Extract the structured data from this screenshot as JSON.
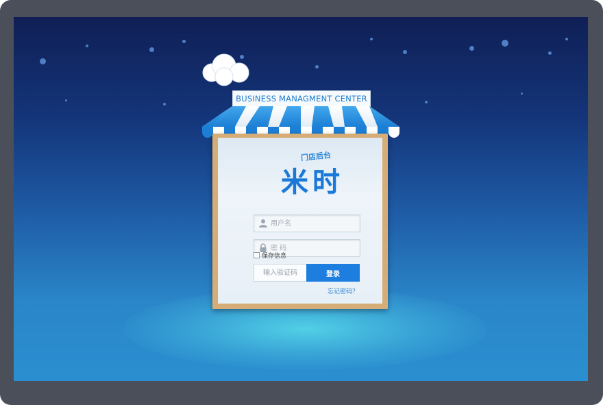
{
  "sign": {
    "title": "BUSINESS MANAGMENT CENTER"
  },
  "logo": {
    "subtitle": "门店后台",
    "name": "米时"
  },
  "form": {
    "username_placeholder": "用户名",
    "password_placeholder": "密 码",
    "remember_label": "保存信息",
    "captcha_placeholder": "输入验证码",
    "login_label": "登录",
    "forgot_label": "忘记密码？"
  },
  "colors": {
    "accent": "#1d7ee0",
    "frame": "#d6ad76",
    "bezel": "#4a4f5a"
  },
  "icons": [
    "user-icon",
    "lock-icon",
    "cloud-icon"
  ]
}
